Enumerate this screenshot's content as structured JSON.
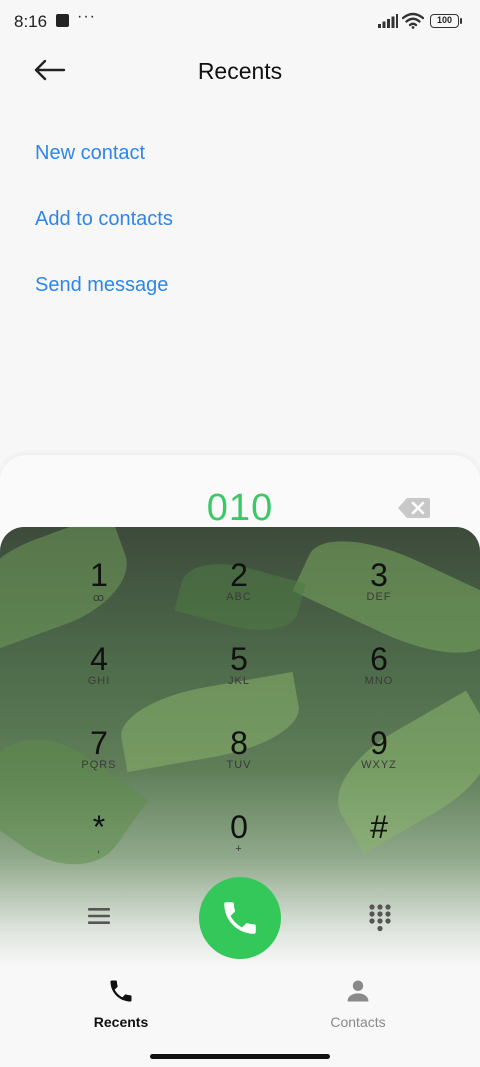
{
  "status_bar": {
    "time": "8:16",
    "notification_dots": "···",
    "battery": "100"
  },
  "header": {
    "title": "Recents"
  },
  "options": [
    {
      "label": "New contact"
    },
    {
      "label": "Add to contacts"
    },
    {
      "label": "Send message"
    }
  ],
  "dialer": {
    "number": "010",
    "keys": [
      {
        "num": "1",
        "sub": "ꝏ"
      },
      {
        "num": "2",
        "sub": "ABC"
      },
      {
        "num": "3",
        "sub": "DEF"
      },
      {
        "num": "4",
        "sub": "GHI"
      },
      {
        "num": "5",
        "sub": "JKL"
      },
      {
        "num": "6",
        "sub": "MNO"
      },
      {
        "num": "7",
        "sub": "PQRS"
      },
      {
        "num": "8",
        "sub": "TUV"
      },
      {
        "num": "9",
        "sub": "WXYZ"
      },
      {
        "num": "*",
        "sub": ","
      },
      {
        "num": "0",
        "sub": "+"
      },
      {
        "num": "#",
        "sub": ""
      }
    ]
  },
  "bottom_nav": [
    {
      "label": "Recents",
      "icon": "phone-icon",
      "active": true
    },
    {
      "label": "Contacts",
      "icon": "person-icon",
      "active": false
    }
  ],
  "colors": {
    "accent_link": "#2e86e8",
    "digits": "#3cc867",
    "call_button": "#34c759",
    "inactive_tab": "#8a8a8a"
  }
}
